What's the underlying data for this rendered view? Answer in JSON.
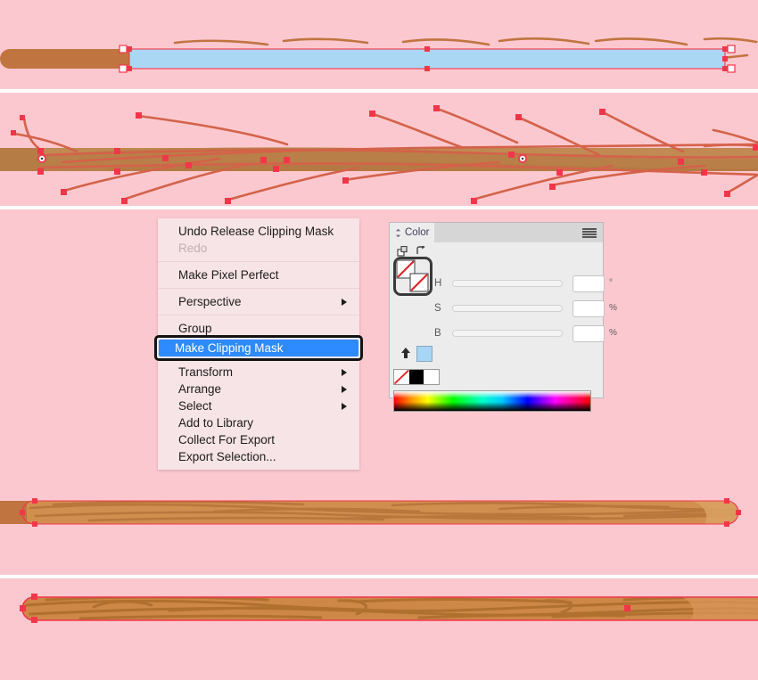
{
  "app": {
    "background_color": "#fcc8cf",
    "divider_color": "#ffffff",
    "artboard_count": 5
  },
  "context_menu": {
    "name": "illustrator-context-menu",
    "background": "#f7e4e6",
    "groups": [
      {
        "items": [
          {
            "label": "Undo Release Clipping Mask",
            "disabled": false,
            "submenu": false
          },
          {
            "label": "Redo",
            "disabled": true,
            "submenu": false
          }
        ]
      },
      {
        "items": [
          {
            "label": "Make Pixel Perfect",
            "disabled": false,
            "submenu": false
          }
        ]
      },
      {
        "items": [
          {
            "label": "Perspective",
            "disabled": false,
            "submenu": true
          }
        ]
      },
      {
        "items": [
          {
            "label": "Group",
            "disabled": false,
            "submenu": false
          },
          {
            "label": "Make Clipping Mask",
            "disabled": false,
            "submenu": false,
            "highlighted": true
          }
        ]
      },
      {
        "items": [
          {
            "label": "Transform",
            "disabled": false,
            "submenu": true
          },
          {
            "label": "Arrange",
            "disabled": false,
            "submenu": true
          },
          {
            "label": "Select",
            "disabled": false,
            "submenu": true
          },
          {
            "label": "Add to Library",
            "disabled": false,
            "submenu": false
          },
          {
            "label": "Collect For Export",
            "disabled": false,
            "submenu": false
          },
          {
            "label": "Export Selection...",
            "disabled": false,
            "submenu": false
          }
        ]
      }
    ],
    "highlight": {
      "label": "Make Clipping Mask",
      "background": "#2e8bff",
      "text_color": "#ffffff",
      "ring_color": "#131313"
    }
  },
  "color_panel": {
    "name": "color-panel",
    "tab_label": "Color",
    "menu_icon": "hamburger-icon",
    "collapse_icon": "chevron-updown-icon",
    "fill_swatch": "none-swatch",
    "stroke_swatch": "none-swatch",
    "swap_icon": "swap-fill-stroke-icon",
    "default_icon": "default-fill-stroke-icon",
    "upload_icon": "add-to-swatches-icon",
    "current_swatch_color": "#a6d5f5",
    "quick_swatches": [
      {
        "name": "none-swatch",
        "color": "none"
      },
      {
        "name": "black-swatch",
        "color": "#000000"
      },
      {
        "name": "white-swatch",
        "color": "#ffffff"
      }
    ],
    "sliders": [
      {
        "key": "H",
        "label": "H",
        "value": "",
        "unit": "°"
      },
      {
        "key": "S",
        "label": "S",
        "value": "",
        "unit": "%"
      },
      {
        "key": "B",
        "label": "B",
        "value": "",
        "unit": "%"
      }
    ],
    "spectrum_label": "color-spectrum-ramp"
  },
  "artwork": {
    "band1": {
      "name": "stick-with-selected-blue-shape",
      "brown_bar_color": "#c07440",
      "selected_rect_color": "#aad7f4",
      "selection_color": "#f2364a",
      "anchor_fill": "#ffffff",
      "grain_color": "#c07440"
    },
    "band2": {
      "name": "wood-grain-paths-selected",
      "bar_color": "#c08a52",
      "bar_dark_color": "#b27a45",
      "grain_color": "#d4624a",
      "anchor_color": "#f2364a"
    },
    "band4": {
      "name": "clipped-wood-stick-light",
      "bar_color": "#d08f4f",
      "grain_color": "#b9773c",
      "tail_color": "#c07440"
    },
    "band5": {
      "name": "clipped-wood-stick-dark",
      "bar_color": "#cd8747",
      "grain_color": "#b0702f",
      "selection_color": "#f2364a"
    }
  }
}
